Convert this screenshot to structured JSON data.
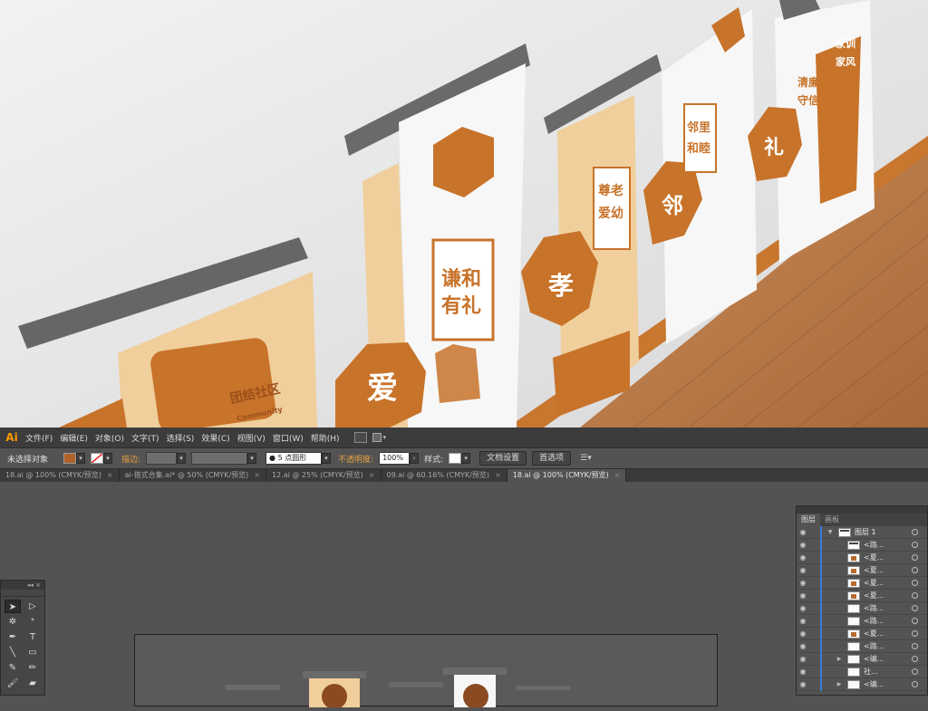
{
  "app": {
    "logo": "Ai",
    "brand_color": "#ff9a00"
  },
  "menu": [
    "文件(F)",
    "编辑(E)",
    "对象(O)",
    "文字(T)",
    "选择(S)",
    "效果(C)",
    "视图(V)",
    "窗口(W)",
    "帮助(H)"
  ],
  "control": {
    "selection_label": "未选择对象",
    "fill_color": "#b0622a",
    "stroke_label": "描边:",
    "brush_value": "5 点圆形",
    "opacity_label": "不透明度:",
    "opacity_value": "100%",
    "style_label": "样式:",
    "doc_setup_button": "文档设置",
    "prefs_button": "首选项"
  },
  "tabs": [
    {
      "label": "18.ai @ 100% (CMYK/预览)",
      "active": false
    },
    {
      "label": "ai-搭式合集.ai* @ 50% (CMYK/预览)",
      "active": false
    },
    {
      "label": "12.ai @ 25% (CMYK/预览)",
      "active": false
    },
    {
      "label": "09.ai @ 60.16% (CMYK/预览)",
      "active": false
    },
    {
      "label": "18.ai @ 100% (CMYK/预览)",
      "active": true
    }
  ],
  "render": {
    "board_texts": [
      "谦和",
      "有礼",
      "尊老",
      "爱幼",
      "邻里",
      "和睦",
      "清廉",
      "守信",
      "家训",
      "家风",
      "爱",
      "孝",
      "邻",
      "礼",
      "团结社区",
      "Community"
    ]
  },
  "layers_panel": {
    "tab_layers": "图层",
    "tab_artboards": "画板",
    "top_layer": "图层 1",
    "rows": [
      {
        "name": "<路...",
        "thumb": "dark",
        "expand": false
      },
      {
        "name": "<夏...",
        "thumb": "brown",
        "expand": false
      },
      {
        "name": "<夏...",
        "thumb": "brown",
        "expand": false
      },
      {
        "name": "<夏...",
        "thumb": "brown",
        "expand": false
      },
      {
        "name": "<夏...",
        "thumb": "brown",
        "expand": false
      },
      {
        "name": "<路...",
        "thumb": "plain",
        "expand": false
      },
      {
        "name": "<路...",
        "thumb": "plain",
        "expand": false
      },
      {
        "name": "<夏...",
        "thumb": "brown",
        "expand": false
      },
      {
        "name": "<路...",
        "thumb": "plain",
        "expand": false
      },
      {
        "name": "<编...",
        "thumb": "plain",
        "expand": true
      },
      {
        "name": "社...",
        "thumb": "plain",
        "expand": false
      },
      {
        "name": "<编...",
        "thumb": "plain",
        "expand": true
      }
    ]
  },
  "tools_panel": {
    "tools": [
      "selection-tool",
      "direct-selection-tool",
      "magic-wand-tool",
      "lasso-tool",
      "pen-tool",
      "type-tool",
      "line-tool",
      "rectangle-tool",
      "paintbrush-tool",
      "pencil-tool",
      "blob-brush-tool",
      "eraser-tool"
    ]
  }
}
